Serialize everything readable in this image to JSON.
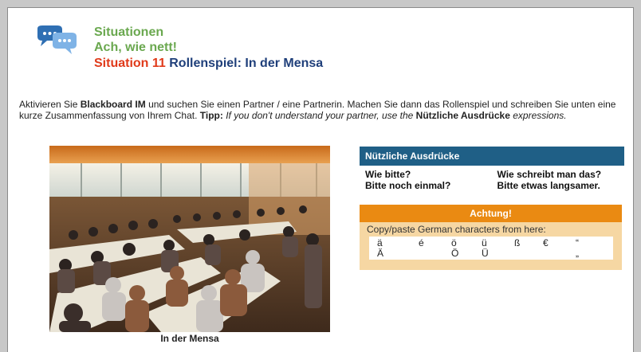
{
  "header": {
    "line1": "Situationen",
    "line2": "Ach, wie nett!",
    "situation_label": "Situation 11",
    "situation_title": "Rollenspiel: In der Mensa"
  },
  "instructions": {
    "p1": "Aktivieren Sie ",
    "b1": "Blackboard IM",
    "p2": " und suchen Sie einen Partner / eine Partnerin. Machen Sie dann das Rollenspiel und schreiben Sie unten eine kurze Zusammenfassung von Ihrem Chat. ",
    "tipp": "Tipp:",
    "italic1": " If you don't understand your partner, use the ",
    "b2": "Nützliche Ausdrücke",
    "italic2": " expressions."
  },
  "photo": {
    "caption": "In der Mensa"
  },
  "nuetzliche": {
    "title": "Nützliche Ausdrücke",
    "phrases": [
      "Wie bitte?",
      "Wie schreibt man das?",
      "Bitte noch einmal?",
      "Bitte etwas langsamer."
    ]
  },
  "achtung": {
    "title": "Achtung!",
    "text": "Copy/paste German characters from here:",
    "chars_row1": [
      "ä",
      "é",
      "ö",
      "ü",
      "ß",
      "€",
      "“"
    ],
    "chars_row2": [
      "Ä",
      "Ö",
      "Ü",
      "„"
    ]
  },
  "colors": {
    "green": "#6aa84f",
    "red": "#e03a1a",
    "navy": "#1f3f7a",
    "panel_blue": "#1f5f86",
    "orange": "#ea8a12",
    "peach": "#f6d7a3"
  }
}
